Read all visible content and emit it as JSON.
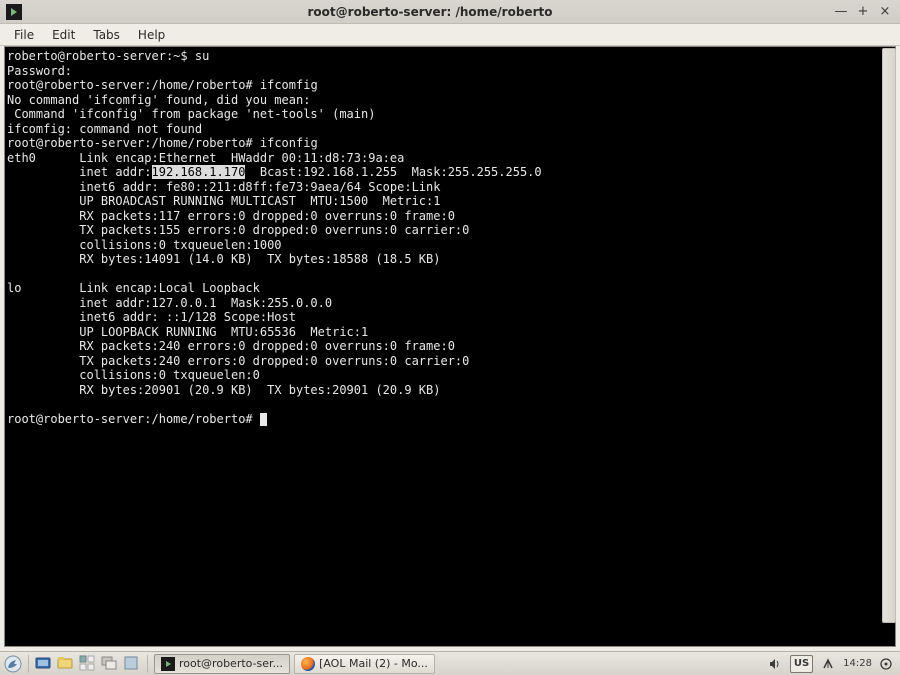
{
  "window": {
    "title": "root@roberto-server: /home/roberto",
    "controls": {
      "minimize": "—",
      "maximize": "+",
      "close": "×"
    }
  },
  "menu": {
    "file": "File",
    "edit": "Edit",
    "tabs": "Tabs",
    "help": "Help"
  },
  "terminal": {
    "l1a": "roberto@roberto-server:~$ ",
    "l1b": "su",
    "l2": "Password:",
    "l3a": "root@roberto-server:/home/roberto# ",
    "l3b": "ifcomfig",
    "l4": "No command 'ifcomfig' found, did you mean:",
    "l5": " Command 'ifconfig' from package 'net-tools' (main)",
    "l6": "ifcomfig: command not found",
    "l7a": "root@roberto-server:/home/roberto# ",
    "l7b": "ifconfig",
    "l8": "eth0      Link encap:Ethernet  HWaddr 00:11:d8:73:9a:ea",
    "l9a": "          inet addr:",
    "l9h": "192.168.1.170",
    "l9b": "  Bcast:192.168.1.255  Mask:255.255.255.0",
    "l10": "          inet6 addr: fe80::211:d8ff:fe73:9aea/64 Scope:Link",
    "l11": "          UP BROADCAST RUNNING MULTICAST  MTU:1500  Metric:1",
    "l12": "          RX packets:117 errors:0 dropped:0 overruns:0 frame:0",
    "l13": "          TX packets:155 errors:0 dropped:0 overruns:0 carrier:0",
    "l14": "          collisions:0 txqueuelen:1000",
    "l15": "          RX bytes:14091 (14.0 KB)  TX bytes:18588 (18.5 KB)",
    "blank1": "",
    "l16": "lo        Link encap:Local Loopback",
    "l17": "          inet addr:127.0.0.1  Mask:255.0.0.0",
    "l18": "          inet6 addr: ::1/128 Scope:Host",
    "l19": "          UP LOOPBACK RUNNING  MTU:65536  Metric:1",
    "l20": "          RX packets:240 errors:0 dropped:0 overruns:0 frame:0",
    "l21": "          TX packets:240 errors:0 dropped:0 overruns:0 carrier:0",
    "l22": "          collisions:0 txqueuelen:0",
    "l23": "          RX bytes:20901 (20.9 KB)  TX bytes:20901 (20.9 KB)",
    "blank2": "",
    "l24": "root@roberto-server:/home/roberto# "
  },
  "taskbar": {
    "task1": "root@roberto-ser...",
    "task2": "[AOL Mail (2) - Mo...",
    "kb": "US",
    "time": "14:28"
  }
}
